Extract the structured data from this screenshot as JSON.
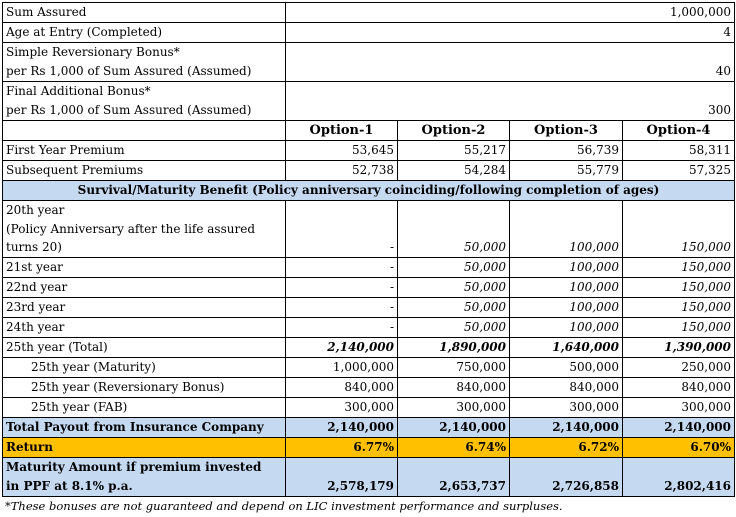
{
  "policy": {
    "sum_assured_label": "Sum Assured",
    "sum_assured_value": "1,000,000",
    "age_label": "Age at Entry (Completed)",
    "age_value": "4",
    "srb_label_1": "Simple Reversionary Bonus*",
    "srb_label_2": "per Rs 1,000 of Sum Assured (Assumed)",
    "srb_value": "40",
    "fab_label_1": "Final Additional Bonus*",
    "fab_label_2": "per Rs 1,000 of Sum Assured (Assumed)",
    "fab_value": "300"
  },
  "options": [
    "Option-1",
    "Option-2",
    "Option-3",
    "Option-4"
  ],
  "premiums": {
    "first_label": "First Year Premium",
    "first": [
      "53,645",
      "55,217",
      "56,739",
      "58,311"
    ],
    "subsequent_label": "Subsequent Premiums",
    "subsequent": [
      "52,738",
      "54,284",
      "55,779",
      "57,325"
    ]
  },
  "section_title": "Survival/Maturity Benefit (Policy anniversary coinciding/following completion of ages)",
  "year20": {
    "line1": "20th year",
    "line2": "(Policy Anniversary after the life assured",
    "line3": "turns 20)",
    "values": [
      "-",
      "50,000",
      "100,000",
      "150,000"
    ]
  },
  "years": [
    {
      "label": "21st year",
      "values": [
        "-",
        "50,000",
        "100,000",
        "150,000"
      ]
    },
    {
      "label": "22nd year",
      "values": [
        "-",
        "50,000",
        "100,000",
        "150,000"
      ]
    },
    {
      "label": "23rd year",
      "values": [
        "-",
        "50,000",
        "100,000",
        "150,000"
      ]
    },
    {
      "label": "24th year",
      "values": [
        "-",
        "50,000",
        "100,000",
        "150,000"
      ]
    }
  ],
  "year25_total": {
    "label": "25th year (Total)",
    "values": [
      "2,140,000",
      "1,890,000",
      "1,640,000",
      "1,390,000"
    ]
  },
  "year25_parts": [
    {
      "label": "25th year (Maturity)",
      "values": [
        "1,000,000",
        "750,000",
        "500,000",
        "250,000"
      ]
    },
    {
      "label": "25th year (Reversionary Bonus)",
      "values": [
        "840,000",
        "840,000",
        "840,000",
        "840,000"
      ]
    },
    {
      "label": "25th year (FAB)",
      "values": [
        "300,000",
        "300,000",
        "300,000",
        "300,000"
      ]
    }
  ],
  "total_payout": {
    "label": "Total Payout from Insurance Company",
    "values": [
      "2,140,000",
      "2,140,000",
      "2,140,000",
      "2,140,000"
    ]
  },
  "return_row": {
    "label": "Return",
    "values": [
      "6.77%",
      "6.74%",
      "6.72%",
      "6.70%"
    ]
  },
  "ppf": {
    "line1": "Maturity Amount if premium invested",
    "line2": "in PPF at 8.1% p.a.",
    "values": [
      "2,578,179",
      "2,653,737",
      "2,726,858",
      "2,802,416"
    ]
  },
  "footnote": "*These bonuses are not guaranteed and depend on LIC investment performance and surpluses.",
  "colors": {
    "band": "#c5d9f1",
    "return": "#ffc000"
  }
}
